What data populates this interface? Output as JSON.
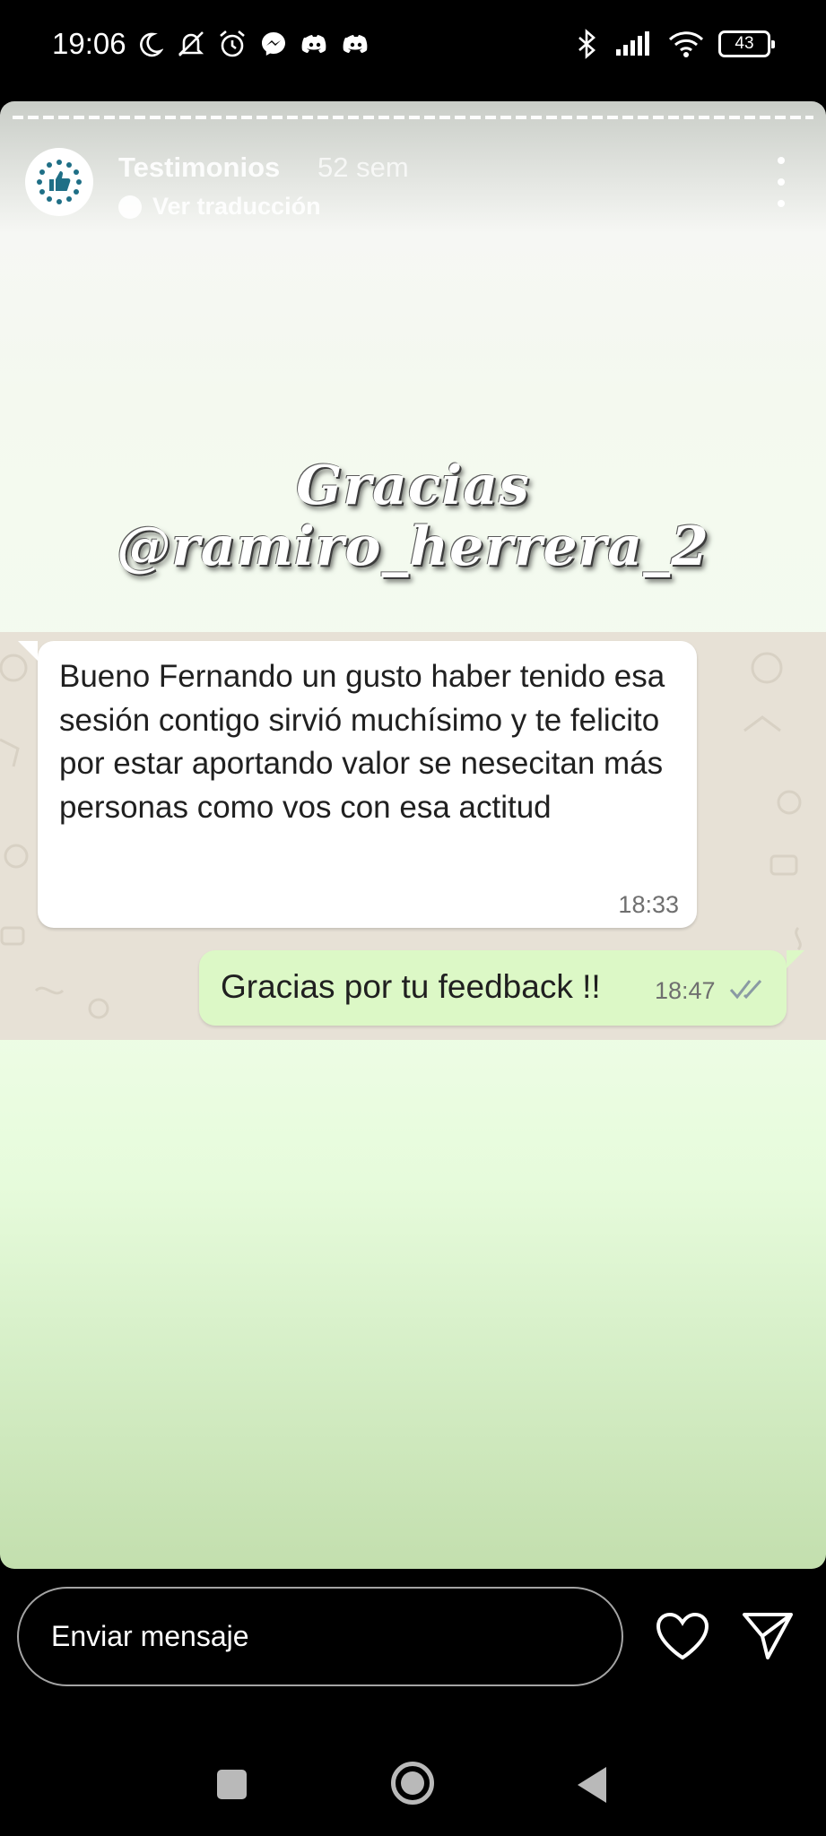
{
  "status_bar": {
    "time": "19:06",
    "battery": "43",
    "left_icons": [
      "moon-icon",
      "bell-off-icon",
      "alarm-icon",
      "messenger-icon",
      "discord-icon",
      "discord-icon"
    ],
    "right_icons": [
      "bluetooth-icon",
      "signal-icon",
      "wifi-icon",
      "battery-icon"
    ]
  },
  "story": {
    "account_name": "Testimonios",
    "time_ago": "52 sem",
    "translate_label": "Ver traducción",
    "overlay_line1": "Gracias",
    "overlay_line2": "@ramiro_herrera_2",
    "accent": "#1f6f86"
  },
  "chat": {
    "incoming": {
      "text": "Bueno Fernando un gusto haber tenido esa sesión contigo sirvió muchísimo y te felicito por estar aportando valor se nesecitan más personas como vos con esa actitud",
      "time": "18:33"
    },
    "outgoing": {
      "text": "Gracias por tu feedback !!",
      "time": "18:47",
      "status": "read-ticks-icon"
    },
    "bubble_out_color": "#dcf8c6"
  },
  "reply": {
    "placeholder": "Enviar mensaje",
    "like_icon": "heart-icon",
    "send_icon": "send-icon"
  },
  "nav": {
    "icons": [
      "recents-icon",
      "home-icon",
      "back-icon"
    ]
  }
}
